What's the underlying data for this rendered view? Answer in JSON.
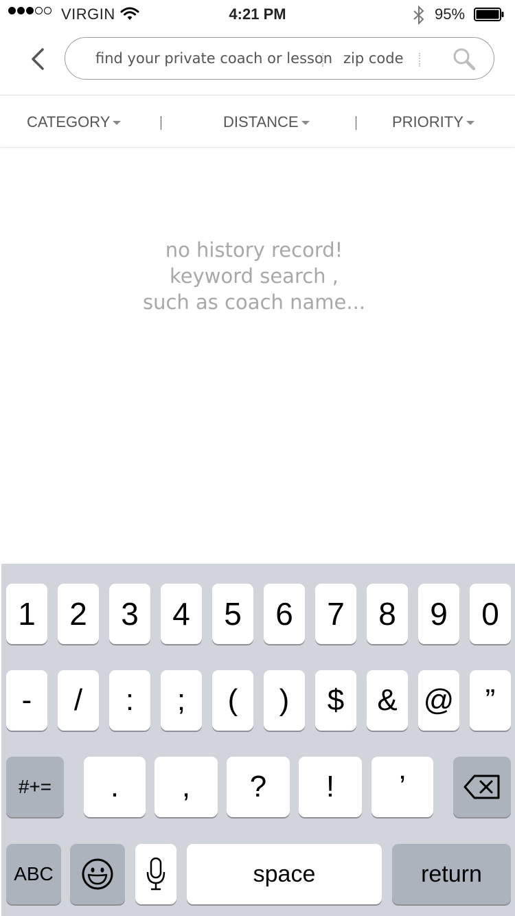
{
  "status_bar": {
    "carrier": "VIRGIN",
    "time": "4:21 PM",
    "battery": "95%",
    "signal_filled": 3,
    "signal_total": 5
  },
  "search": {
    "query_placeholder": "find your private coach or lesson",
    "zip_placeholder": "zip code"
  },
  "filters": [
    {
      "label": "CATEGORY"
    },
    {
      "label": "DISTANCE"
    },
    {
      "label": "PRIORITY"
    }
  ],
  "empty_state": {
    "line1": "no history record!",
    "line2": "keyword search ,",
    "line3": "such as coach name..."
  },
  "keyboard": {
    "row1": [
      "1",
      "2",
      "3",
      "4",
      "5",
      "6",
      "7",
      "8",
      "9",
      "0"
    ],
    "row2": [
      "-",
      "/",
      ":",
      ";",
      "(",
      ")",
      "$",
      "&",
      "@",
      "”"
    ],
    "row3": [
      ".",
      ",",
      "?",
      "!",
      "’"
    ],
    "symbols_key": "#+=",
    "abc_key": "ABC",
    "space_key": "space",
    "return_key": "return"
  },
  "icons": {
    "back": "chevron-left-icon",
    "search": "magnifier-icon",
    "wifi": "wifi-icon",
    "bluetooth": "bluetooth-icon",
    "battery": "battery-icon",
    "emoji": "emoji-icon",
    "mic": "microphone-icon",
    "delete": "backspace-icon"
  },
  "colors": {
    "keyboard_bg": "#d1d5db",
    "gray_key": "#adb3bc",
    "empty_text": "#a8a8a8"
  }
}
